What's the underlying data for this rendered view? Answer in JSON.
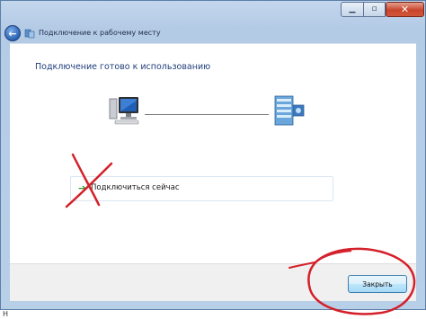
{
  "window": {
    "title": "Подключение к рабочему месту",
    "controls": {
      "minimize_icon": "minimize-icon",
      "maximize_icon": "maximize-icon",
      "close_icon": "close-icon"
    },
    "back_icon": "back-arrow-icon",
    "title_icon": "network-folder-icon"
  },
  "content": {
    "heading": "Подключение готово к использованию",
    "client_icon": "computer-icon",
    "server_icon": "server-icon",
    "option": {
      "label": "Подключиться сейчас",
      "icon": "green-arrow-icon"
    }
  },
  "footer": {
    "close_label": "Закрыть"
  },
  "bottom_label": "Н",
  "annotations": {
    "color": "#d4202a",
    "cross": "red-x-mark",
    "circle": "red-circle-mark"
  }
}
